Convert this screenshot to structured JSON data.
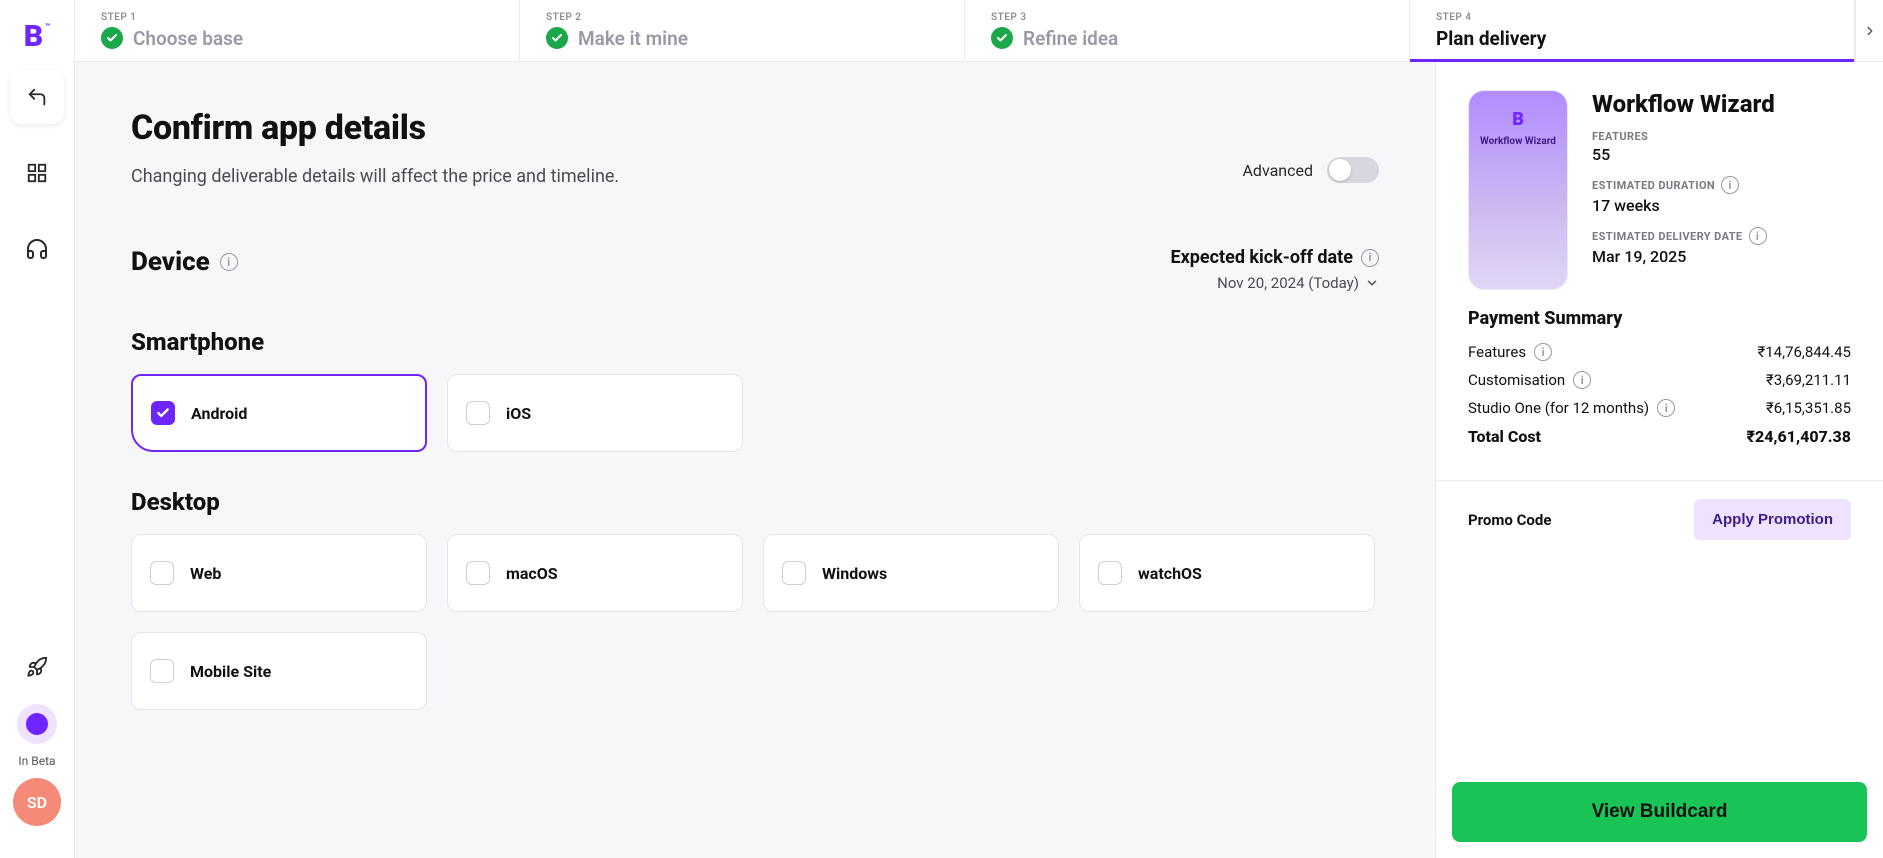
{
  "sidebar": {
    "beta_label": "In Beta",
    "avatar_initials": "SD"
  },
  "stepper": {
    "steps": [
      {
        "num": "STEP 1",
        "title": "Choose base",
        "done": true
      },
      {
        "num": "STEP 2",
        "title": "Make it mine",
        "done": true
      },
      {
        "num": "STEP 3",
        "title": "Refine idea",
        "done": true
      },
      {
        "num": "STEP 4",
        "title": "Plan delivery",
        "done": false
      }
    ]
  },
  "page": {
    "heading": "Confirm app details",
    "subheading": "Changing deliverable details will affect the price and timeline.",
    "advanced_label": "Advanced",
    "device_heading": "Device",
    "kickoff_label": "Expected kick-off date",
    "kickoff_date": "Nov 20, 2024 (Today)",
    "smartphone_heading": "Smartphone",
    "desktop_heading": "Desktop",
    "smartphone_options": [
      {
        "label": "Android",
        "checked": true
      },
      {
        "label": "iOS",
        "checked": false
      }
    ],
    "desktop_options": [
      {
        "label": "Web",
        "checked": false
      },
      {
        "label": "macOS",
        "checked": false
      },
      {
        "label": "Windows",
        "checked": false
      },
      {
        "label": "watchOS",
        "checked": false
      },
      {
        "label": "Mobile Site",
        "checked": false
      }
    ]
  },
  "summary": {
    "app_name": "Workflow Wizard",
    "phone_caption": "Workflow Wizard",
    "features_label": "FEATURES",
    "features_value": "55",
    "duration_label": "ESTIMATED DURATION",
    "duration_value": "17 weeks",
    "delivery_label": "ESTIMATED DELIVERY DATE",
    "delivery_value": "Mar 19, 2025",
    "payment_title": "Payment Summary",
    "rows": [
      {
        "label": "Features",
        "info": true,
        "value": "₹14,76,844.45"
      },
      {
        "label": "Customisation",
        "info": true,
        "value": "₹3,69,211.11"
      },
      {
        "label": "Studio One (for 12 months)",
        "info": true,
        "value": "₹6,15,351.85"
      }
    ],
    "total_label": "Total Cost",
    "total_value": "₹24,61,407.38",
    "promo_label": "Promo Code",
    "promo_button": "Apply Promotion",
    "cta": "View Buildcard"
  }
}
